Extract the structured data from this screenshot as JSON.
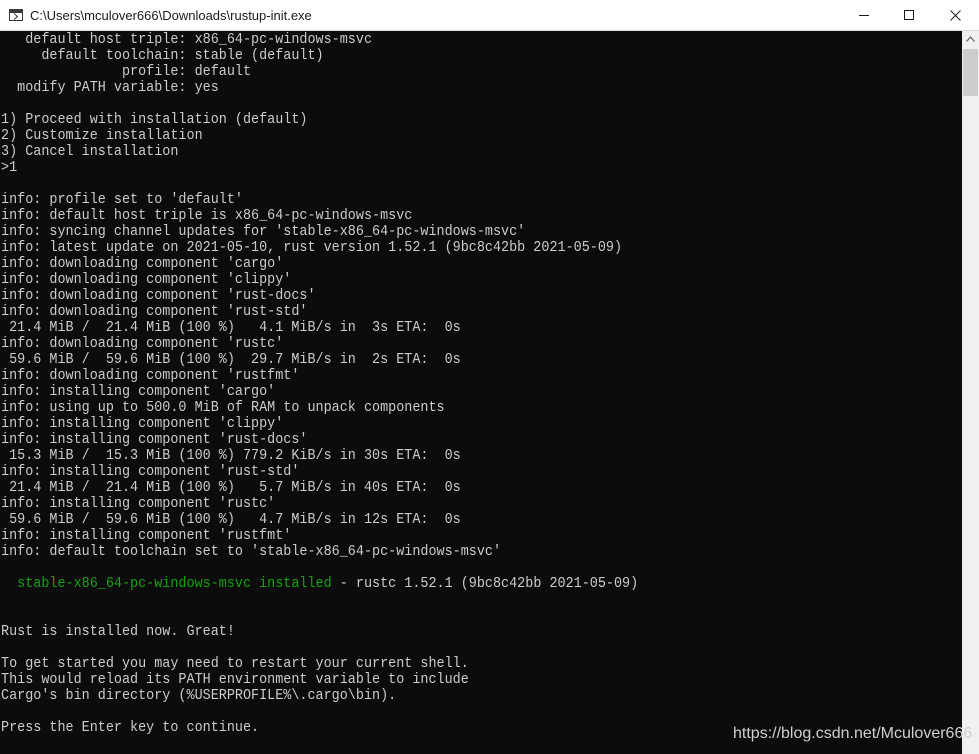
{
  "window": {
    "title": "C:\\Users\\mculover666\\Downloads\\rustup-init.exe"
  },
  "colors": {
    "console_bg": "#0c0c0c",
    "console_text": "#cccccc",
    "success_green": "#13a10e"
  },
  "console": {
    "lines": [
      "   default host triple: x86_64-pc-windows-msvc",
      "     default toolchain: stable (default)",
      "               profile: default",
      "  modify PATH variable: yes",
      "",
      "1) Proceed with installation (default)",
      "2) Customize installation",
      "3) Cancel installation",
      ">1",
      "",
      "info: profile set to 'default'",
      "info: default host triple is x86_64-pc-windows-msvc",
      "info: syncing channel updates for 'stable-x86_64-pc-windows-msvc'",
      "info: latest update on 2021-05-10, rust version 1.52.1 (9bc8c42bb 2021-05-09)",
      "info: downloading component 'cargo'",
      "info: downloading component 'clippy'",
      "info: downloading component 'rust-docs'",
      "info: downloading component 'rust-std'",
      " 21.4 MiB /  21.4 MiB (100 %)   4.1 MiB/s in  3s ETA:  0s",
      "info: downloading component 'rustc'",
      " 59.6 MiB /  59.6 MiB (100 %)  29.7 MiB/s in  2s ETA:  0s",
      "info: downloading component 'rustfmt'",
      "info: installing component 'cargo'",
      "info: using up to 500.0 MiB of RAM to unpack components",
      "info: installing component 'clippy'",
      "info: installing component 'rust-docs'",
      " 15.3 MiB /  15.3 MiB (100 %) 779.2 KiB/s in 30s ETA:  0s",
      "info: installing component 'rust-std'",
      " 21.4 MiB /  21.4 MiB (100 %)   5.7 MiB/s in 40s ETA:  0s",
      "info: installing component 'rustc'",
      " 59.6 MiB /  59.6 MiB (100 %)   4.7 MiB/s in 12s ETA:  0s",
      "info: installing component 'rustfmt'",
      "info: default toolchain set to 'stable-x86_64-pc-windows-msvc'",
      ""
    ],
    "installed_green": "  stable-x86_64-pc-windows-msvc installed",
    "installed_rest": " - rustc 1.52.1 (9bc8c42bb 2021-05-09)",
    "closing_lines": [
      "",
      "",
      "Rust is installed now. Great!",
      "",
      "To get started you may need to restart your current shell.",
      "This would reload its PATH environment variable to include",
      "Cargo's bin directory (%USERPROFILE%\\.cargo\\bin).",
      "",
      "Press the Enter key to continue."
    ]
  },
  "watermark": "https://blog.csdn.net/Mculover666"
}
